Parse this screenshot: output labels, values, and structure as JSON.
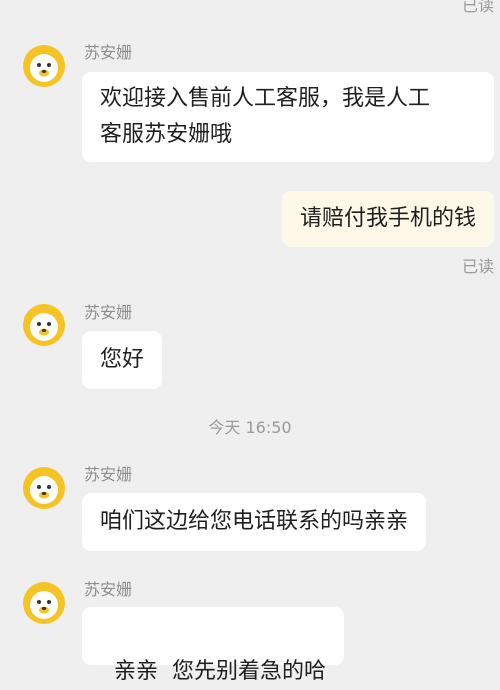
{
  "read_label": "已读",
  "time_divider": "今天 16:50",
  "colors": {
    "background": "#efefef",
    "agent_bubble": "#ffffff",
    "user_bubble": "#fdf8e8",
    "avatar_yellow": "#f5c323"
  },
  "messages": [
    {
      "sender": "苏安姗",
      "text_line1": "欢迎接入售前人工客服，我是人工",
      "text_line2": "客服苏安姗哦",
      "avatar_icon": "lion-avatar-icon"
    },
    {
      "text": "请赔付我手机的钱"
    },
    {
      "sender": "苏安姗",
      "text": "您好",
      "avatar_icon": "lion-avatar-icon"
    },
    {
      "sender": "苏安姗",
      "text": "咱们这边给您电话联系的吗亲亲",
      "avatar_icon": "lion-avatar-icon"
    },
    {
      "sender": "苏安姗",
      "text": "亲亲  您先别着急的哈",
      "avatar_icon": "lion-avatar-icon"
    }
  ]
}
